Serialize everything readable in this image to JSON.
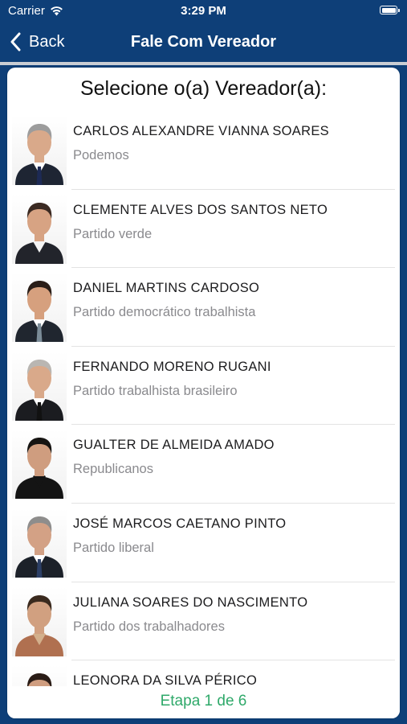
{
  "status_bar": {
    "carrier": "Carrier",
    "time": "3:29 PM",
    "battery_level": 1.0
  },
  "nav": {
    "back_label": "Back",
    "title": "Fale Com Vereador"
  },
  "card": {
    "heading": "Selecione o(a) Vereador(a):",
    "step_label": "Etapa 1 de 6"
  },
  "councilors": [
    {
      "name": "CARLOS ALEXANDRE VIANNA SOARES",
      "party": "Podemos",
      "photo": {
        "hair": "#9c9c9c",
        "skin": "#d9a98a",
        "suit": "#1e2533",
        "shirt": "#ffffff",
        "tie": "#1d2a55"
      }
    },
    {
      "name": "CLEMENTE ALVES DOS SANTOS NETO",
      "party": "Partido verde",
      "photo": {
        "hair": "#3b2a22",
        "skin": "#d7a383",
        "suit": "#22242b",
        "shirt": "#f4f4f4",
        "tie": ""
      }
    },
    {
      "name": "DANIEL MARTINS CARDOSO",
      "party": "Partido democrático trabalhista",
      "photo": {
        "hair": "#2a1e18",
        "skin": "#d6a07e",
        "suit": "#20262f",
        "shirt": "#ffffff",
        "tie": "#7b8c98"
      }
    },
    {
      "name": "FERNANDO MORENO RUGANI",
      "party": "Partido trabalhista brasileiro",
      "photo": {
        "hair": "#b9b6b2",
        "skin": "#d9a98a",
        "suit": "#1b1c20",
        "shirt": "#ffffff",
        "tie": "#111111"
      }
    },
    {
      "name": "GUALTER DE ALMEIDA AMADO",
      "party": "Republicanos",
      "photo": {
        "hair": "#161412",
        "skin": "#cf9d7f",
        "suit": "#141414",
        "shirt": "#141414",
        "tie": ""
      }
    },
    {
      "name": "JOSÉ MARCOS CAETANO PINTO",
      "party": "Partido liberal",
      "photo": {
        "hair": "#8e8d8c",
        "skin": "#d3a185",
        "suit": "#1c2129",
        "shirt": "#ffffff",
        "tie": "#2c3f66"
      }
    },
    {
      "name": "JULIANA SOARES DO NASCIMENTO",
      "party": "Partido dos trabalhadores",
      "photo": {
        "hair": "#3a2a1e",
        "skin": "#d1a080",
        "suit": "#b07050",
        "shirt": "#d3b08c",
        "tie": ""
      }
    },
    {
      "name": "LEONORA DA SILVA PÉRICO",
      "party": "",
      "photo": {
        "hair": "#2a1c16",
        "skin": "#cf9d7f",
        "suit": "#2e2e2e",
        "shirt": "#ffffff",
        "tie": ""
      }
    }
  ],
  "colors": {
    "nav_background": "#0e3f78",
    "step_label": "#2fa96a",
    "party_text": "#8a8a8e"
  }
}
